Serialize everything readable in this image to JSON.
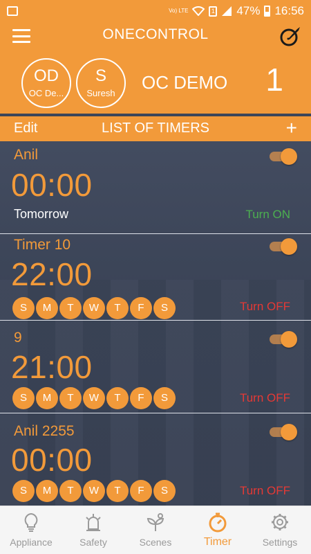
{
  "colors": {
    "accent": "#f29a3a",
    "list_bg": "#3d4659",
    "turn_on": "#4caf50",
    "turn_off": "#e53935",
    "nav_inactive": "#9a9a9a"
  },
  "status_bar": {
    "volte": "Vo) LTE",
    "sim": "1",
    "battery": "47%",
    "time": "16:56"
  },
  "header": {
    "title": "ONECONTROL",
    "menu_icon": "hamburger-icon",
    "edit_icon": "pen-circle-icon",
    "avatars": [
      {
        "initials": "OD",
        "name": "OC De..."
      },
      {
        "initials": "S",
        "name": "Suresh"
      }
    ],
    "home_name": "OC DEMO",
    "count": "1"
  },
  "subheader": {
    "edit_label": "Edit",
    "title": "LIST OF TIMERS",
    "add_label": "+"
  },
  "timers": [
    {
      "name": "Anil",
      "time": "00:00",
      "schedule": "Tomorrow",
      "action": "Turn ON",
      "enabled": true
    },
    {
      "name": "Timer 10",
      "time": "22:00",
      "days": [
        "S",
        "M",
        "T",
        "W",
        "T",
        "F",
        "S"
      ],
      "action": "Turn OFF",
      "enabled": true
    },
    {
      "name": "9",
      "time": "21:00",
      "days": [
        "S",
        "M",
        "T",
        "W",
        "T",
        "F",
        "S"
      ],
      "action": "Turn OFF",
      "enabled": true
    },
    {
      "name": "Anil 2255",
      "time": "00:00",
      "days": [
        "S",
        "M",
        "T",
        "W",
        "T",
        "F",
        "S"
      ],
      "action": "Turn OFF",
      "enabled": true
    }
  ],
  "bottom_nav": [
    {
      "label": "Appliance",
      "icon": "lightbulb-icon",
      "active": false
    },
    {
      "label": "Safety",
      "icon": "siren-icon",
      "active": false
    },
    {
      "label": "Scenes",
      "icon": "scenes-icon",
      "active": false
    },
    {
      "label": "Timer",
      "icon": "stopwatch-icon",
      "active": true
    },
    {
      "label": "Settings",
      "icon": "gear-icon",
      "active": false
    }
  ]
}
